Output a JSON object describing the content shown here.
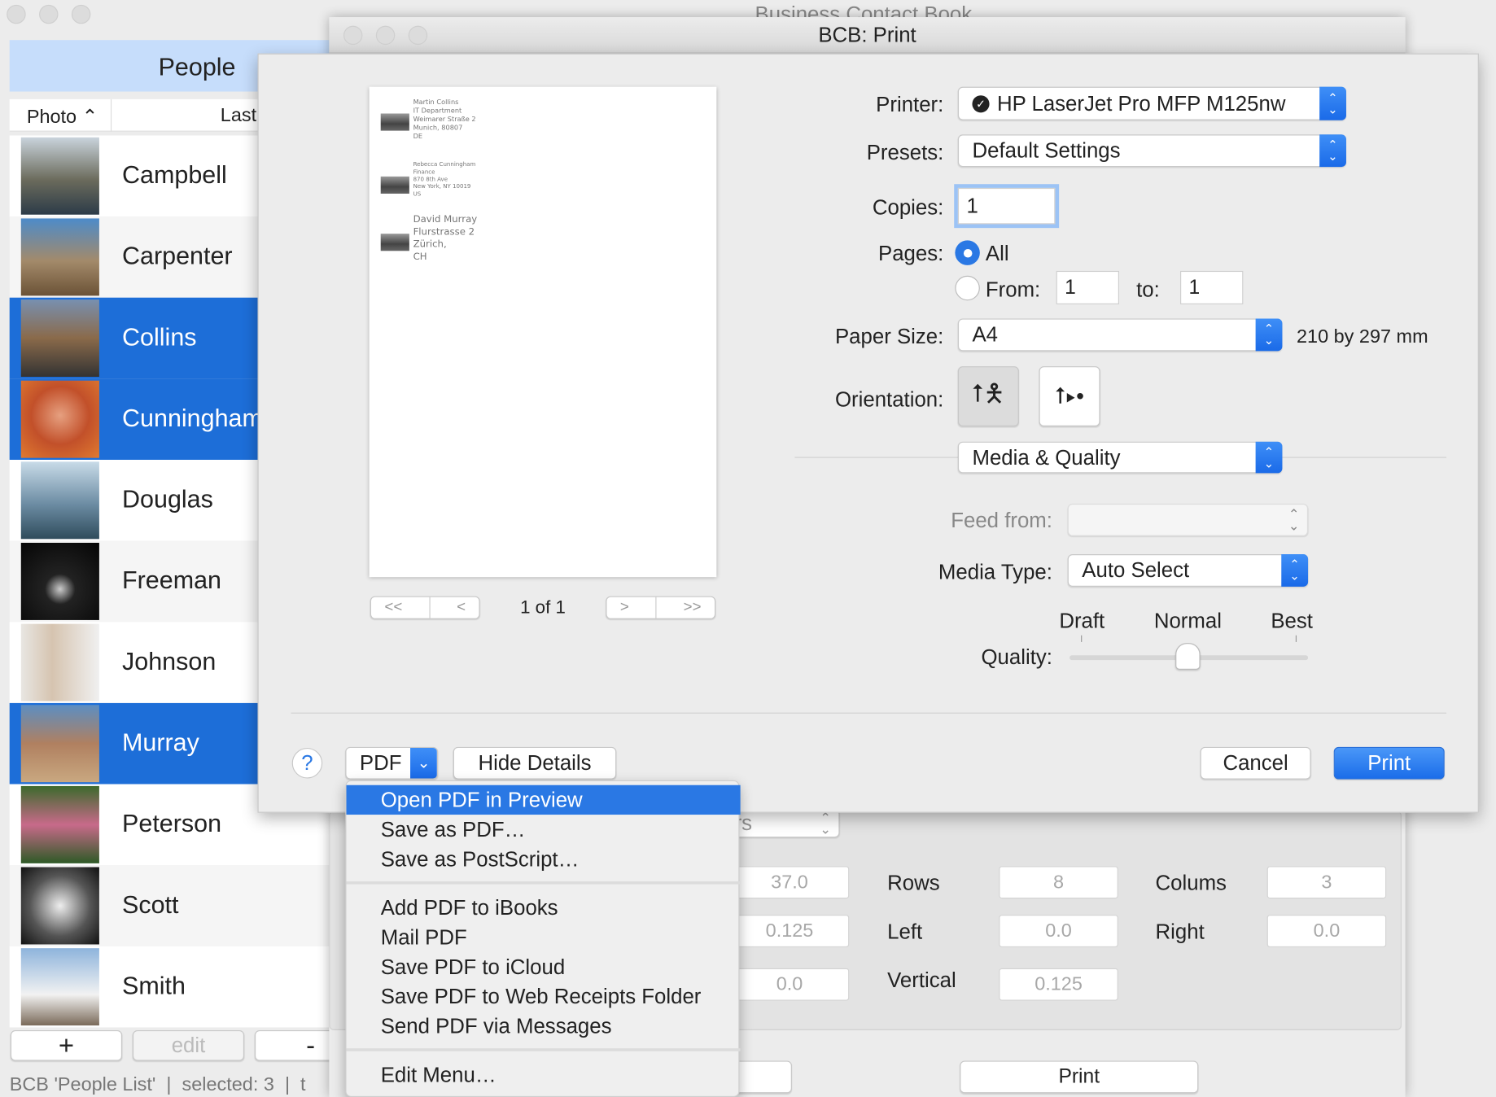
{
  "main_window": {
    "title": "Business Contact Book",
    "people_header": "People",
    "col_photo": "Photo",
    "col_last": "Last",
    "rows": [
      {
        "name": "Campbell",
        "selected": false
      },
      {
        "name": "Carpenter",
        "selected": false
      },
      {
        "name": "Collins",
        "selected": true
      },
      {
        "name": "Cunningham",
        "selected": true
      },
      {
        "name": "Douglas",
        "selected": false
      },
      {
        "name": "Freeman",
        "selected": false
      },
      {
        "name": "Johnson",
        "selected": false
      },
      {
        "name": "Murray",
        "selected": true
      },
      {
        "name": "Peterson",
        "selected": false
      },
      {
        "name": "Scott",
        "selected": false
      },
      {
        "name": "Smith",
        "selected": false
      }
    ],
    "add_label": "+",
    "edit_label": "edit",
    "remove_label": "-",
    "status": "BCB 'People List'  |  selected: 3  |  t"
  },
  "underlying": {
    "popup_partial": "rs",
    "v1": "37.0",
    "rows_label": "Rows",
    "rows_val": "8",
    "cols_label": "Colums",
    "cols_val": "3",
    "v2": "0.125",
    "left_label": "Left",
    "left_val": "0.0",
    "right_label": "Right",
    "right_val": "0.0",
    "v3": "0.0",
    "vertical_label": "Vertical",
    "vertical_val": "0.125",
    "print_label": "Print"
  },
  "dialog": {
    "title": "BCB: Print",
    "preview": {
      "entries": [
        [
          "Martin Collins",
          "IT Department",
          "Weimarer Straße 2",
          "Munich, 80807",
          "DE"
        ],
        [
          "Rebecca Cunningham",
          "Finance",
          "870 8th Ave",
          "New York, NY 10019",
          "US"
        ],
        [
          "David Murray",
          "Flurstrasse 2",
          "Zürich,",
          "CH"
        ]
      ],
      "page_indicator": "1 of 1",
      "first": "<<",
      "prev": "<",
      "next": ">",
      "last": ">>"
    },
    "printer_label": "Printer:",
    "printer": "HP LaserJet Pro MFP M125nw",
    "presets_label": "Presets:",
    "presets": "Default Settings",
    "copies_label": "Copies:",
    "copies": "1",
    "pages_label": "Pages:",
    "all_label": "All",
    "pages_all_selected": true,
    "from_label": "From:",
    "from": "1",
    "to_label": "to:",
    "to": "1",
    "paper_label": "Paper Size:",
    "paper": "A4",
    "paper_dims": "210 by 297 mm",
    "orientation_label": "Orientation:",
    "orientation": "portrait",
    "section": "Media & Quality",
    "feed_label": "Feed from:",
    "feed": "",
    "media_label": "Media Type:",
    "media": "Auto Select",
    "quality_label": "Quality:",
    "quality_ticks": [
      "Draft",
      "Normal",
      "Best"
    ],
    "quality_value": "Normal",
    "help": "?",
    "pdf_label": "PDF",
    "hide_details": "Hide Details",
    "cancel": "Cancel",
    "print": "Print",
    "accent": "#2a78e4"
  },
  "pdf_menu": {
    "group1": [
      "Open PDF in Preview",
      "Save as PDF…",
      "Save as PostScript…"
    ],
    "group2": [
      "Add PDF to iBooks",
      "Mail PDF",
      "Save PDF to iCloud",
      "Save PDF to Web Receipts Folder",
      "Send PDF via Messages"
    ],
    "group3": [
      "Edit Menu…"
    ],
    "highlighted": "Open PDF in Preview"
  }
}
